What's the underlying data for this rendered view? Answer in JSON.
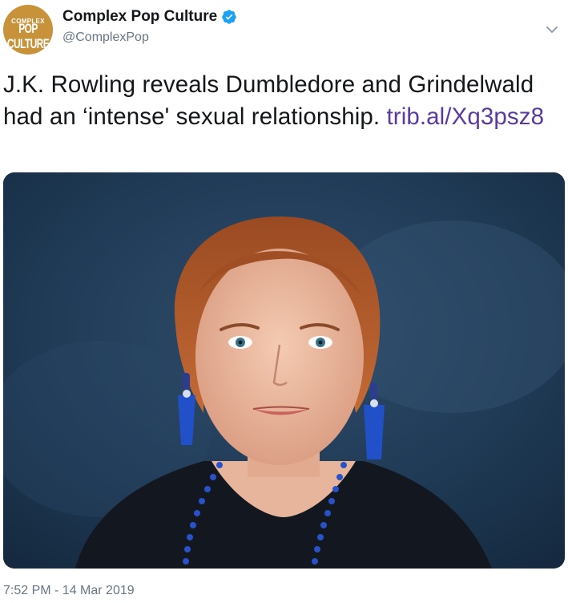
{
  "account": {
    "display_name": "Complex Pop Culture",
    "handle": "@ComplexPop",
    "verified": true,
    "avatar_top": "COMPLEX",
    "avatar_bottom": "POP CULTURE"
  },
  "tweet": {
    "text_before_link": "J.K. Rowling reveals Dumbledore and Grindelwald had an ‘intense' sexual relationship. ",
    "link_text": "trib.al/Xq3psz8",
    "timestamp": "7:52 PM - 14 Mar 2019"
  },
  "icons": {
    "verified": "verified-badge-icon",
    "menu": "chevron-down-icon"
  },
  "colors": {
    "link": "#5a3aa0",
    "verified": "#1da1f2",
    "secondary_text": "#657786",
    "avatar_bg": "#c8923b"
  }
}
